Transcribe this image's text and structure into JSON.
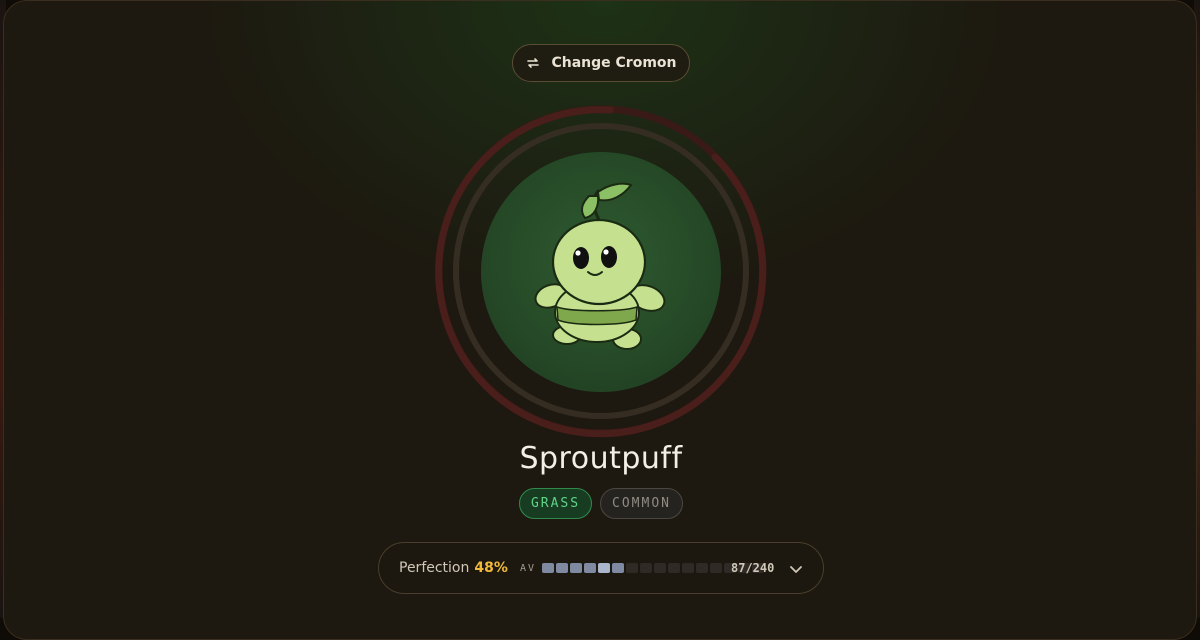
{
  "header": {
    "change_button_label": "Change Cromon",
    "change_icon": "swap-arrows-icon"
  },
  "cromon": {
    "name": "Sproutpuff",
    "type_badge": "GRASS",
    "rarity_badge": "COMMON"
  },
  "stats": {
    "perfection_label": "Perfection",
    "perfection_value": "48%",
    "av_label": "AV",
    "av_score": "87/240",
    "av_fraction": 0.3625,
    "av_segments_total": 16,
    "av_segments_filled": 6,
    "expand_icon": "chevron-down-icon"
  },
  "colors": {
    "accent_gold": "#f0b93a",
    "grass_green": "#5fd487",
    "panel_bg": "#1d1810"
  }
}
